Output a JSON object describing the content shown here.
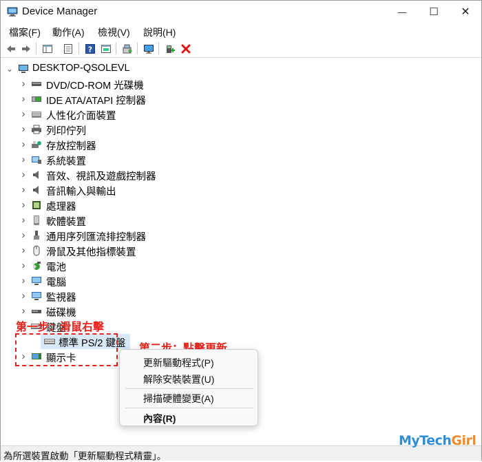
{
  "window": {
    "title": "Device Manager",
    "minimize_glyph": "—",
    "maximize_glyph": "☐",
    "close_glyph": "✕"
  },
  "menu": [
    {
      "label": "檔案(F)"
    },
    {
      "label": "動作(A)"
    },
    {
      "label": "檢視(V)"
    },
    {
      "label": "說明(H)"
    }
  ],
  "toolbar": {
    "icons": [
      "back-arrow-icon",
      "forward-arrow-icon",
      "show-hide-console-tree-icon",
      "properties-icon",
      "help-icon",
      "action-pane-icon",
      "scan-hardware-icon",
      "display-monitor-icon",
      "add-driver-icon",
      "uninstall-device-icon"
    ]
  },
  "tree": {
    "root": "DESKTOP-QSOLEVL",
    "categories": [
      {
        "label": "DVD/CD-ROM 光碟機",
        "icon": "dvd-drive-icon"
      },
      {
        "label": "IDE ATA/ATAPI 控制器",
        "icon": "ide-controller-icon"
      },
      {
        "label": "人性化介面裝置",
        "icon": "hid-icon"
      },
      {
        "label": "列印佇列",
        "icon": "printer-icon"
      },
      {
        "label": "存放控制器",
        "icon": "storage-controller-icon"
      },
      {
        "label": "系統裝置",
        "icon": "system-device-icon"
      },
      {
        "label": "音效、視訊及遊戲控制器",
        "icon": "speaker-icon"
      },
      {
        "label": "音訊輸入與輸出",
        "icon": "audio-io-icon"
      },
      {
        "label": "處理器",
        "icon": "processor-icon"
      },
      {
        "label": "軟體裝置",
        "icon": "software-device-icon"
      },
      {
        "label": "通用序列匯流排控制器",
        "icon": "usb-icon"
      },
      {
        "label": "滑鼠及其他指標裝置",
        "icon": "mouse-icon"
      },
      {
        "label": "電池",
        "icon": "battery-icon"
      },
      {
        "label": "電腦",
        "icon": "computer-icon"
      },
      {
        "label": "監視器",
        "icon": "monitor-icon"
      },
      {
        "label": "磁碟機",
        "icon": "disk-drive-icon"
      },
      {
        "label": "鍵盤",
        "icon": "keyboard-icon"
      },
      {
        "label": "標準 PS/2 鍵盤",
        "icon": "keyboard-icon"
      },
      {
        "label": "顯示卡",
        "icon": "display-adapter-icon"
      }
    ]
  },
  "context_menu": {
    "items": [
      {
        "label": "更新驅動程式(P)"
      },
      {
        "label": "解除安裝裝置(U)"
      },
      {
        "label": "掃描硬體變更(A)"
      },
      {
        "label": "內容(R)"
      }
    ]
  },
  "annotations": {
    "step1": "第一步：滑鼠右擊",
    "step2": "第二步：點擊更新"
  },
  "status_bar": {
    "text": "為所選裝置啟動「更新驅動程式精靈」。"
  },
  "watermark": {
    "text_a": "MyTech",
    "text_b": "Girl"
  },
  "colors": {
    "annotation": "#e8221c",
    "watermark": "#2f8fd6"
  }
}
